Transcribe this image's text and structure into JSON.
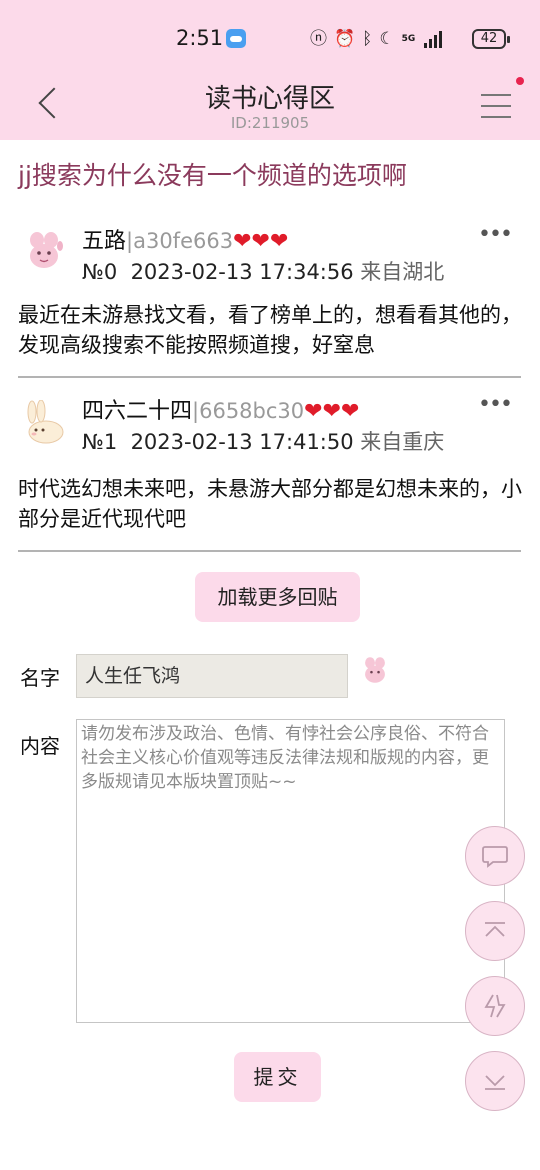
{
  "status_bar": {
    "time": "2:51",
    "network": "5G",
    "battery": "42"
  },
  "header": {
    "title": "读书心得区",
    "id_label": "ID:211905"
  },
  "topic": {
    "title": "jj搜索为什么没有一个频道的选项啊"
  },
  "posts": [
    {
      "name": "五路",
      "user_id": "|a30fe663",
      "hearts": "❤❤❤",
      "floor": "№0",
      "datetime": "2023-02-13 17:34:56",
      "location": "来自湖北",
      "content": "最近在未游悬找文看，看了榜单上的，想看看其他的，发现高级搜索不能按照频道搜，好窒息"
    },
    {
      "name": "四六二十四",
      "user_id": "|6658bc30",
      "hearts": "❤❤❤",
      "floor": "№1",
      "datetime": "2023-02-13 17:41:50",
      "location": "来自重庆",
      "content": "时代选幻想未来吧，未悬游大部分都是幻想未来的，小部分是近代现代吧"
    }
  ],
  "load_more_label": "加载更多回贴",
  "form": {
    "name_label": "名字",
    "name_value": "人生任飞鸿",
    "content_label": "内容",
    "content_placeholder": "请勿发布涉及政治、色情、有悖社会公序良俗、不符合社会主义核心价值观等违反法律法规和版规的内容，更多版规请见本版块置顶贴~~",
    "submit_label": "提交"
  },
  "colors": {
    "header_bg": "#fcdaea",
    "topic_title": "#8b3a5c",
    "heart": "#e01c2a",
    "notification_dot": "#e8234f"
  },
  "icons": {
    "back": "chevron-left-icon",
    "menu": "hamburger-menu-icon",
    "more": "more-dots-icon",
    "comment": "comment-bubble-icon",
    "scroll_top": "arrow-up-to-top-icon",
    "refresh": "refresh-swap-icon",
    "scroll_bottom": "arrow-down-to-bottom-icon"
  }
}
